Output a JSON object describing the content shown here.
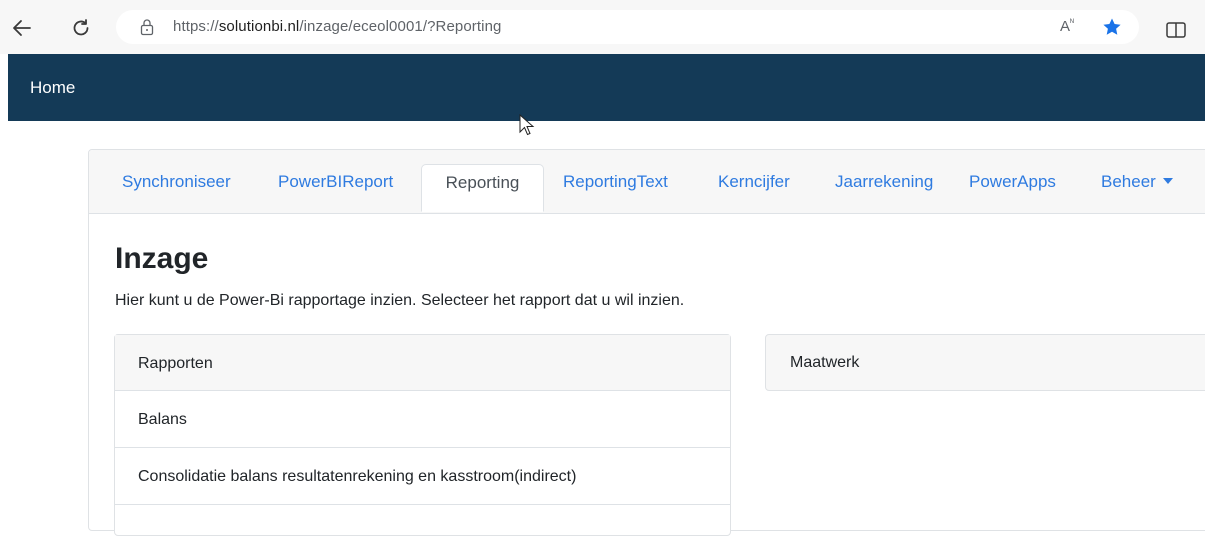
{
  "browser": {
    "url_prefix": "https://",
    "url_domain": "solutionbi.nl",
    "url_path": "/inzage/eceol0001/?Reporting",
    "read_aloud": "Ăᴺ",
    "icons": [
      "back-arrow-icon",
      "refresh-icon",
      "lock-icon",
      "read-aloud-icon",
      "favorite-star-icon",
      "split-screen-icon"
    ],
    "star_color": "#1a73e8"
  },
  "navbar": {
    "home_label": "Home",
    "bg_color": "#143a57"
  },
  "tabs": [
    {
      "label": "Synchroniseer"
    },
    {
      "label": "PowerBIReport"
    },
    {
      "label": "Reporting",
      "active": true
    },
    {
      "label": "ReportingText"
    },
    {
      "label": "Kerncijfer"
    },
    {
      "label": "Jaarrekening"
    },
    {
      "label": "PowerApps"
    },
    {
      "label": "Beheer"
    }
  ],
  "main": {
    "title": "Inzage",
    "description": "Hier kunt u de Power-Bi rapportage inzien. Selecteer het rapport dat u wil inzien."
  },
  "rapporten": {
    "header": "Rapporten",
    "items": [
      "Balans",
      "Consolidatie balans resultatenrekening en kasstroom(indirect)"
    ]
  },
  "maatwerk": {
    "header": "Maatwerk"
  }
}
